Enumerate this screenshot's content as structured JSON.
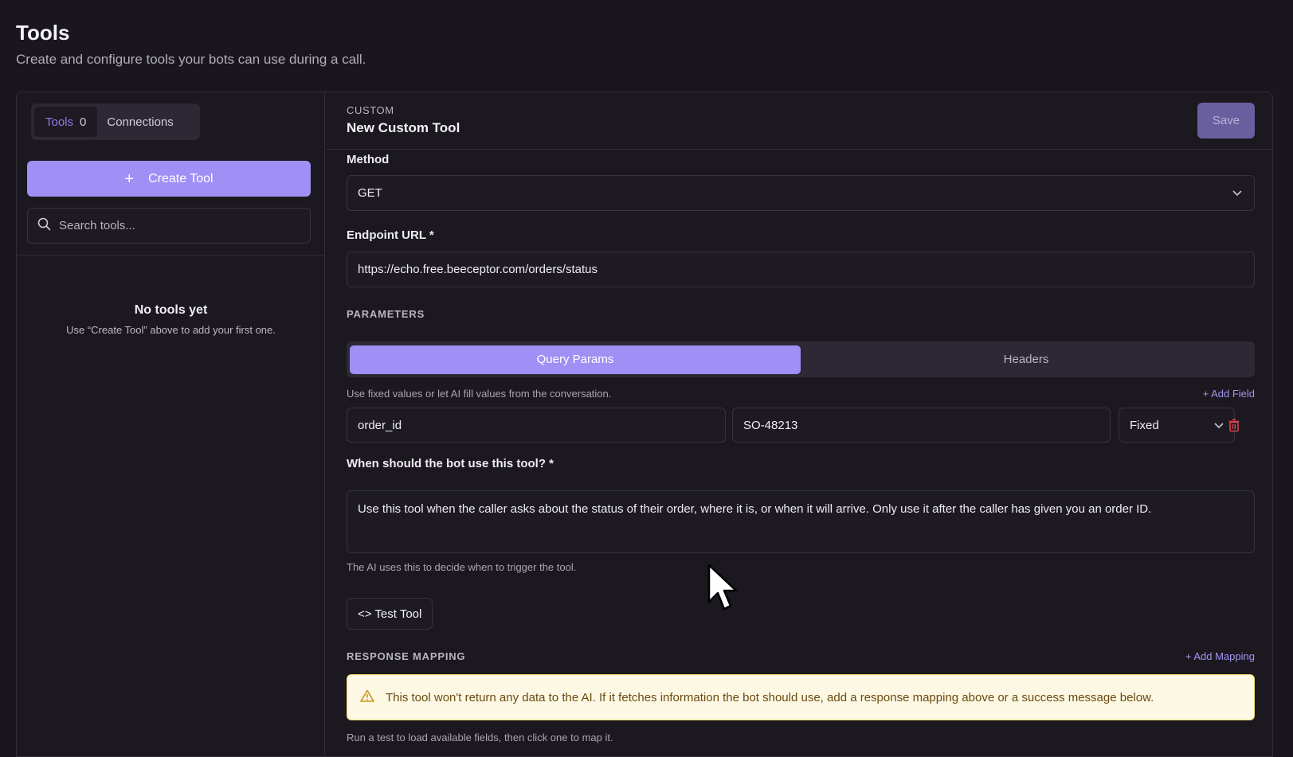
{
  "page": {
    "title": "Tools",
    "subtitle": "Create and configure tools your bots can use during a call."
  },
  "sidebar": {
    "tabs": {
      "tools_label": "Tools",
      "tools_count": "0",
      "connections_label": "Connections"
    },
    "create_label": "Create Tool",
    "search_placeholder": "Search tools...",
    "empty_title": "No tools yet",
    "empty_hint": "Use “Create Tool” above to add your first one."
  },
  "editor": {
    "kind": "CUSTOM",
    "name": "New Custom Tool",
    "save_label": "Save",
    "method_label": "Method",
    "method_value": "GET",
    "endpoint_label": "Endpoint URL *",
    "endpoint_value": "https://echo.free.beeceptor.com/orders/status",
    "parameters_label": "PARAMETERS",
    "param_tabs": [
      "Query Params",
      "Headers"
    ],
    "param_hint": "Use fixed values or let AI fill values from the conversation.",
    "add_field_label": "+ Add Field",
    "param_row": {
      "key": "order_id",
      "value": "SO-48213",
      "mode": "Fixed"
    },
    "when_label": "When should the bot use this tool? *",
    "when_value": "Use this tool when the caller asks about the status of their order, where it is, or when it will arrive. Only use it after the caller has given you an order ID.",
    "when_hint": "The AI uses this to decide when to trigger the tool.",
    "test_label": "<> Test Tool",
    "response_label": "RESPONSE MAPPING",
    "add_mapping_label": "+ Add Mapping",
    "warning_text": "This tool won't return any data to the AI. If it fetches information the bot should use, add a response mapping above or a success message below.",
    "footer_hint": "Run a test to load available fields, then click one to map it."
  },
  "colors": {
    "accent": "#a08ff4",
    "warning_bg": "#fdf8e3",
    "danger": "#e0424a"
  }
}
